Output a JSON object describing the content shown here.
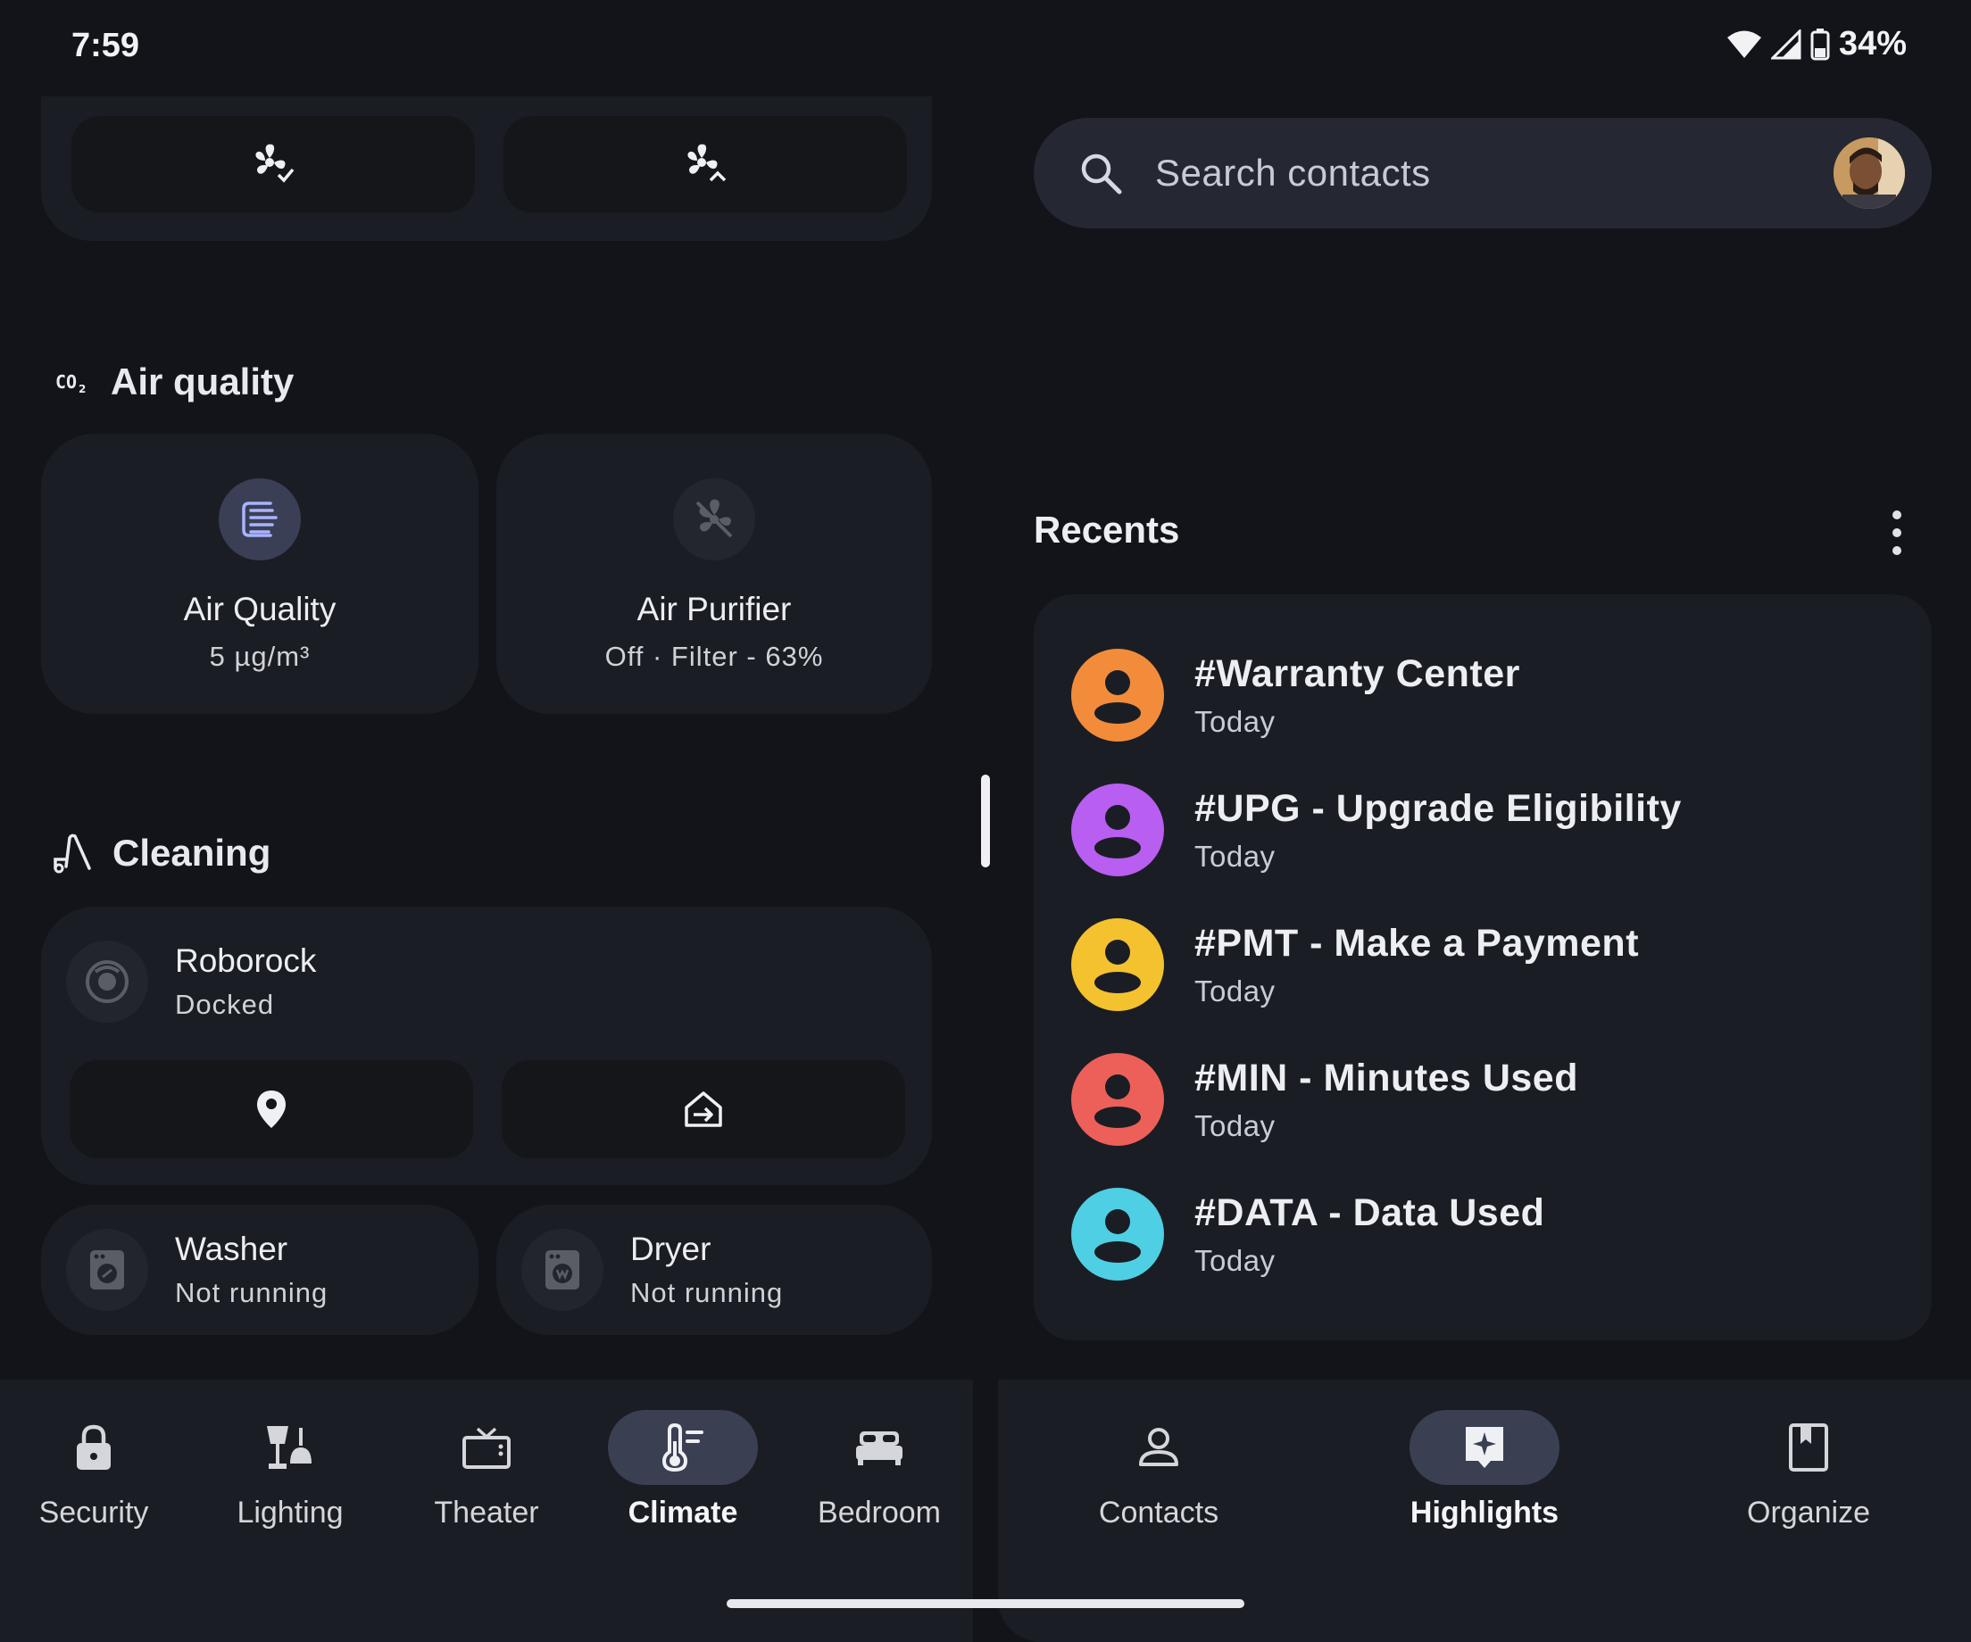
{
  "status_bar": {
    "time": "7:59",
    "battery": "34%"
  },
  "home_app": {
    "air_quality_section": {
      "title": "Air quality",
      "tiles": [
        {
          "title": "Air Quality",
          "subtitle": "5 µg/m³"
        },
        {
          "title": "Air Purifier",
          "subtitle": "Off · Filter - 63%"
        }
      ]
    },
    "cleaning_section": {
      "title": "Cleaning",
      "robot": {
        "title": "Roborock",
        "subtitle": "Docked"
      },
      "washer": {
        "title": "Washer",
        "subtitle": "Not running"
      },
      "dryer": {
        "title": "Dryer",
        "subtitle": "Not running"
      }
    },
    "nav": [
      {
        "label": "Security",
        "icon": "lock-icon"
      },
      {
        "label": "Lighting",
        "icon": "lamp-icon"
      },
      {
        "label": "Theater",
        "icon": "tv-icon"
      },
      {
        "label": "Climate",
        "icon": "thermometer-icon",
        "active": true
      },
      {
        "label": "Bedroom",
        "icon": "bed-icon"
      }
    ]
  },
  "contacts_app": {
    "search": {
      "placeholder": "Search contacts"
    },
    "recents": {
      "title": "Recents",
      "items": [
        {
          "name": "#Warranty Center",
          "time": "Today",
          "color": "#f28c3a"
        },
        {
          "name": "#UPG - Upgrade Eligibility",
          "time": "Today",
          "color": "#b85ef0"
        },
        {
          "name": "#PMT - Make a Payment",
          "time": "Today",
          "color": "#f4c22e"
        },
        {
          "name": "#MIN - Minutes Used",
          "time": "Today",
          "color": "#ec6059"
        },
        {
          "name": "#DATA - Data Used",
          "time": "Today",
          "color": "#4fcfe3"
        }
      ]
    },
    "nav": [
      {
        "label": "Contacts",
        "icon": "person-icon"
      },
      {
        "label": "Highlights",
        "icon": "sparkle-icon",
        "active": true
      },
      {
        "label": "Organize",
        "icon": "bookmark-icon"
      }
    ]
  },
  "colors": {
    "background": "#12141a",
    "card": "#1b1d24",
    "accent_pill": "#3a3f52",
    "aq_icon_bg": "#3a3f55",
    "aq_icon": "#a9b4ff"
  }
}
